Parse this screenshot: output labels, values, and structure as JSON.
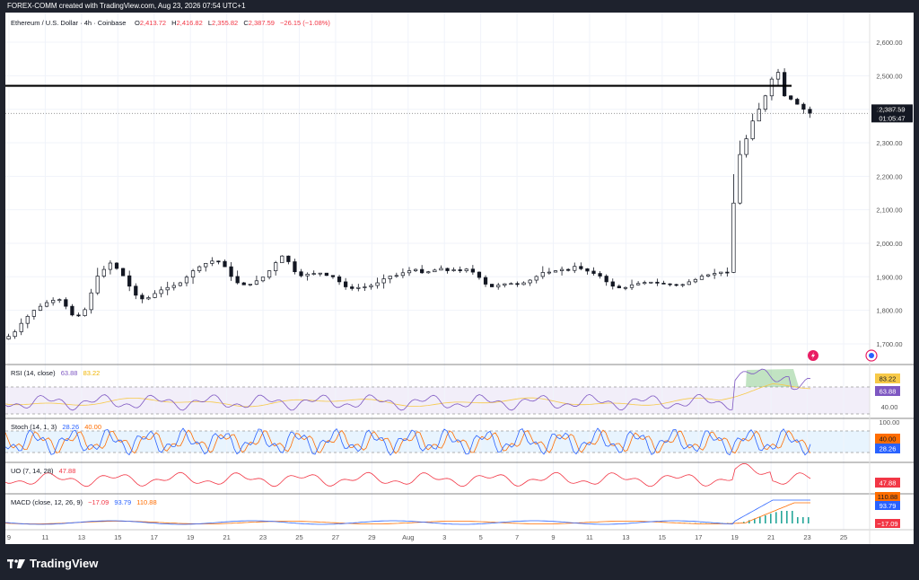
{
  "header": {
    "caption": "FOREX-COMM created with TradingView.com, Aug 23, 2026 07:54 UTC+1"
  },
  "footer": {
    "brand": "TradingView"
  },
  "colors": {
    "up": "#089981",
    "down": "#f23645",
    "rsi": "#7e57c2",
    "rsi_ma": "#f7c948",
    "stoch_k": "#2962ff",
    "stoch_d": "#ff6d00",
    "uo": "#f23645",
    "macd": "#2962ff",
    "signal": "#ff6d00"
  },
  "main": {
    "legend": {
      "symbol": "Ethereum / U.S. Dollar · 4h · Coinbase",
      "open_label": "O",
      "open": "2,413.72",
      "high_label": "H",
      "high": "2,416.82",
      "low_label": "L",
      "low": "2,355.82",
      "close_label": "C",
      "close": "2,387.59",
      "change": "−26.15 (−1.08%)"
    },
    "price_tag": "2,387.59",
    "countdown": "01:05:47"
  },
  "rsi_pane": {
    "legend": "RSI (14, close)",
    "v1": "63.88",
    "v2": "83.22",
    "tag1": "83.22",
    "tag2": "63.88",
    "axis": [
      "40.00"
    ]
  },
  "stoch_pane": {
    "legend": "Stoch (14, 1, 3)",
    "v1": "28.26",
    "v2": "40.00",
    "tag1": "40.00",
    "tag2": "28.26",
    "axis": [
      "100.00"
    ]
  },
  "uo_pane": {
    "legend": "UO (7, 14, 28)",
    "v1": "47.88",
    "tag1": "47.88"
  },
  "macd_pane": {
    "legend": "MACD (close, 12, 26, 9)",
    "v1": "−17.09",
    "v2": "93.79",
    "v3": "110.88",
    "tag1": "110.88",
    "tag2": "93.79",
    "tag3": "−17.09"
  },
  "chart_data": {
    "type": "line",
    "title": "Ethereum / U.S. Dollar · 4h · Coinbase",
    "x_ticks": [
      "9",
      "11",
      "13",
      "15",
      "17",
      "19",
      "21",
      "23",
      "25",
      "27",
      "29",
      "Aug",
      "3",
      "5",
      "7",
      "9",
      "11",
      "13",
      "15",
      "17",
      "19",
      "21",
      "23",
      "25"
    ],
    "y_ticks": [
      "2,600.00",
      "2,500.00",
      "2,400.00",
      "2,300.00",
      "2,200.00",
      "2,100.00",
      "2,000.00",
      "1,900.00",
      "1,800.00",
      "1,700.00"
    ],
    "ylim": [
      1665,
      2635
    ],
    "resistance_level": 2470,
    "last_price": 2387.59,
    "series": [
      {
        "values": [
          1722,
          1736,
          1761,
          1782,
          1800,
          1812,
          1823,
          1830,
          1832,
          1812,
          1786,
          1784,
          1802,
          1852,
          1902,
          1922,
          1941,
          1925,
          1903,
          1872,
          1845,
          1834,
          1838,
          1850,
          1861,
          1868,
          1874,
          1882,
          1899,
          1918,
          1930,
          1940,
          1947,
          1946,
          1930,
          1901,
          1882,
          1876,
          1878,
          1888,
          1899,
          1918,
          1942,
          1962,
          1945,
          1915,
          1903,
          1908,
          1910,
          1911,
          1904,
          1900,
          1885,
          1870,
          1865,
          1868,
          1870,
          1874,
          1882,
          1894,
          1902,
          1904,
          1912,
          1918,
          1922,
          1912,
          1915,
          1920,
          1925,
          1918,
          1921,
          1918,
          1923,
          1914,
          1898,
          1878,
          1870,
          1875,
          1879,
          1880,
          1877,
          1882,
          1890,
          1901,
          1913,
          1914,
          1918,
          1922,
          1919,
          1931,
          1924,
          1917,
          1910,
          1902,
          1885,
          1872,
          1867,
          1868,
          1876,
          1880,
          1883,
          1884,
          1881,
          1879,
          1877,
          1876,
          1877,
          1885,
          1892,
          1902,
          1906,
          1910,
          1914,
          1913,
          2120,
          2265,
          2312,
          2365,
          2400,
          2440,
          2490,
          2510,
          2440,
          2430,
          2415,
          2400,
          2388
        ]
      }
    ]
  }
}
